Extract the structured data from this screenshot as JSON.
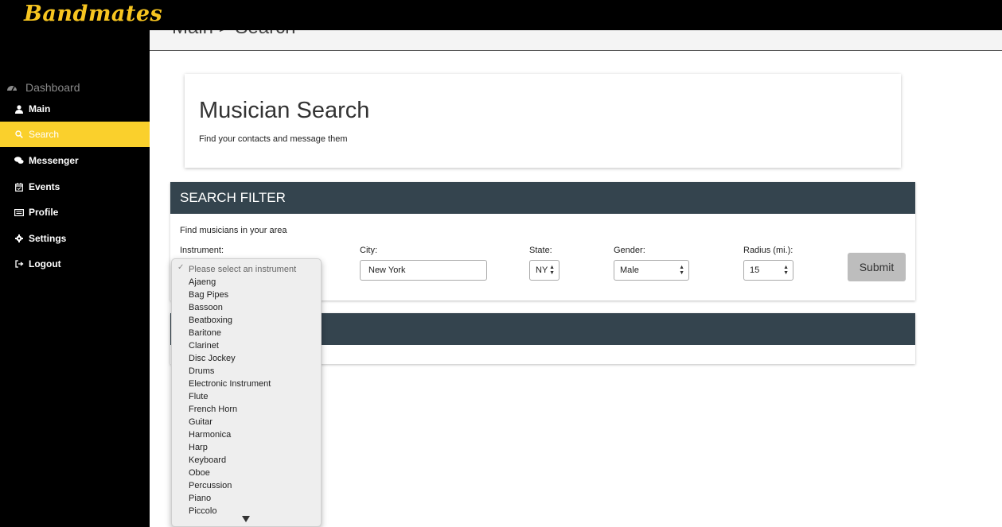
{
  "app": {
    "logo": "Bandmates"
  },
  "header": {
    "breadcrumb": "Main > Search"
  },
  "sidebar": {
    "heading": "Dashboard",
    "items": [
      {
        "label": "Main",
        "icon": "user-icon"
      },
      {
        "label": "Search",
        "icon": "search-icon",
        "active": true
      },
      {
        "label": "Messenger",
        "icon": "chat-icon"
      },
      {
        "label": "Events",
        "icon": "calendar-icon"
      },
      {
        "label": "Profile",
        "icon": "profile-card-icon"
      },
      {
        "label": "Settings",
        "icon": "gear-icon"
      },
      {
        "label": "Logout",
        "icon": "logout-icon"
      }
    ]
  },
  "page": {
    "title": "Musician Search",
    "subtitle": "Find your contacts and message them"
  },
  "filter": {
    "heading": "SEARCH FILTER",
    "subtitle": "Find musicians in your area",
    "instrument_label": "Instrument:",
    "city_label": "City:",
    "city_value": "New York",
    "state_label": "State:",
    "state_value": "NY",
    "gender_label": "Gender:",
    "gender_value": "Male",
    "radius_label": "Radius (mi.):",
    "radius_value": "15",
    "submit_label": "Submit"
  },
  "instrument_dropdown": {
    "placeholder": "Please select an instrument",
    "options": [
      "Ajaeng",
      "Bag Pipes",
      "Bassoon",
      "Beatboxing",
      "Baritone",
      "Clarinet",
      "Disc Jockey",
      "Drums",
      "Electronic Instrument",
      "Flute",
      "French Horn",
      "Guitar",
      "Harmonica",
      "Harp",
      "Keyboard",
      "Oboe",
      "Percussion",
      "Piano",
      "Piccolo"
    ]
  },
  "colors": {
    "accent": "#fad02c",
    "logo": "#f7c520",
    "panel_header": "#34444e",
    "sidebar_bg": "#000000"
  }
}
